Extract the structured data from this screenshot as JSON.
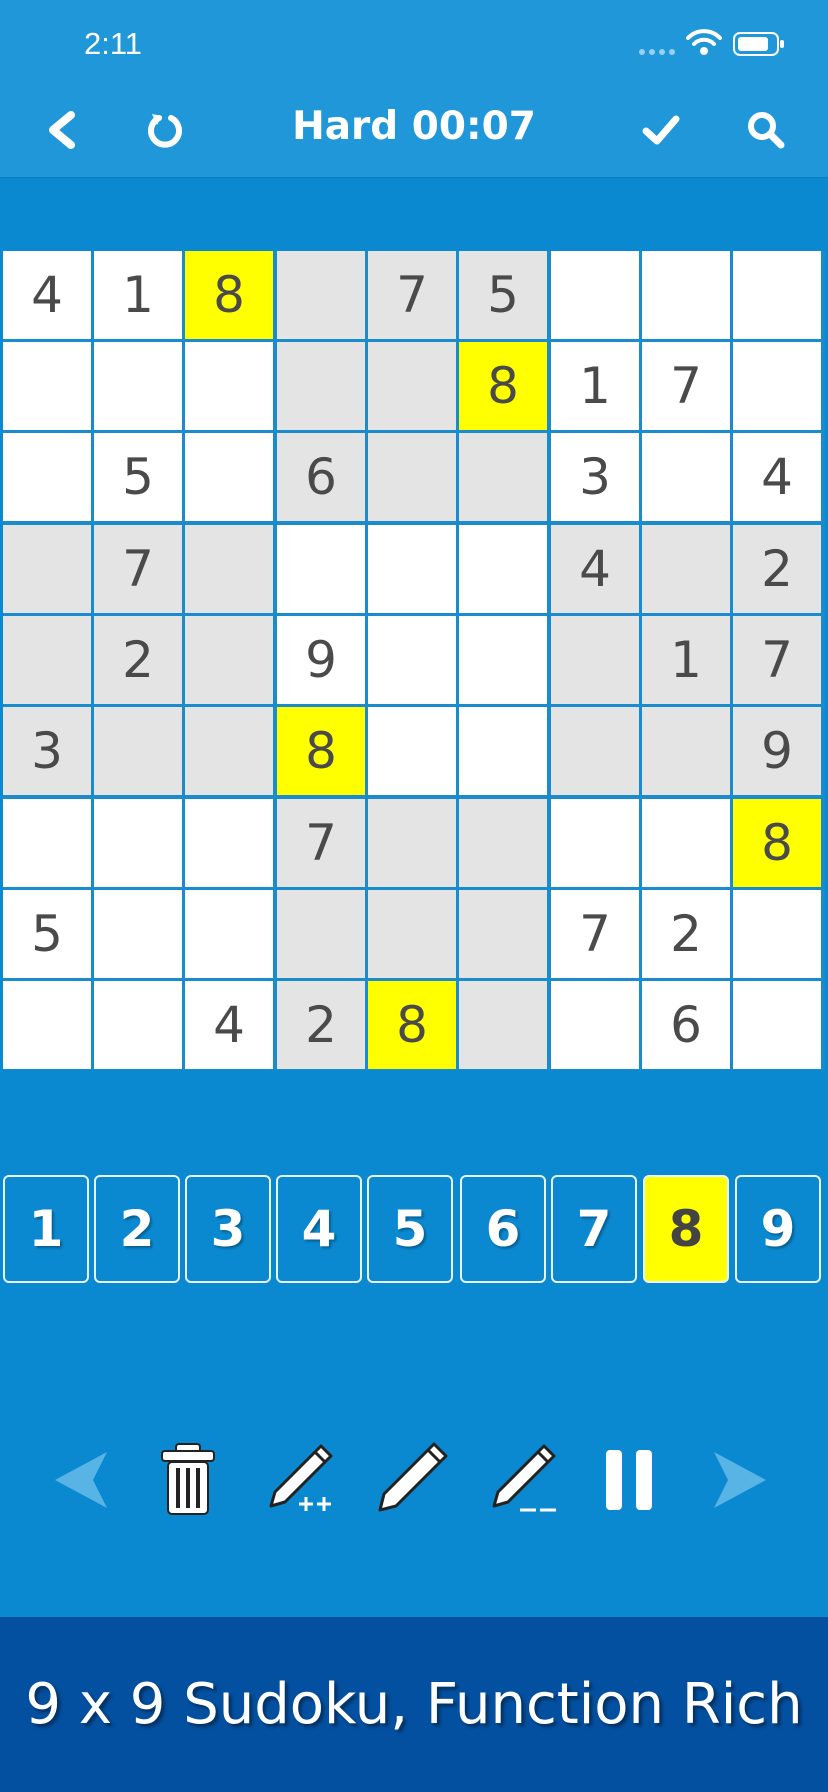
{
  "status_bar": {
    "time": "2:11"
  },
  "header": {
    "title": "Hard 00:07"
  },
  "board": {
    "rows": [
      [
        "4",
        "1",
        "8",
        "",
        "7",
        "5",
        "",
        "",
        ""
      ],
      [
        "",
        "",
        "",
        "",
        "",
        "8",
        "1",
        "7",
        ""
      ],
      [
        "",
        "5",
        "",
        "6",
        "",
        "",
        "3",
        "",
        "4"
      ],
      [
        "",
        "7",
        "",
        "",
        "",
        "",
        "4",
        "",
        "2"
      ],
      [
        "",
        "2",
        "",
        "9",
        "",
        "",
        "",
        "1",
        "7"
      ],
      [
        "3",
        "",
        "",
        "8",
        "",
        "",
        "",
        "",
        "9"
      ],
      [
        "",
        "",
        "",
        "7",
        "",
        "",
        "",
        "",
        "8"
      ],
      [
        "5",
        "",
        "",
        "",
        "",
        "",
        "7",
        "2",
        ""
      ],
      [
        "",
        "",
        "4",
        "2",
        "8",
        "",
        "",
        "6",
        ""
      ]
    ],
    "highlighted_digit": "8"
  },
  "number_pad": [
    "1",
    "2",
    "3",
    "4",
    "5",
    "6",
    "7",
    "8",
    "9"
  ],
  "toolbar": {
    "icons": [
      "undo-arrow-icon",
      "trash-icon",
      "pencil-plus-icon",
      "pencil-icon",
      "pencil-minus-icon",
      "pause-icon",
      "redo-arrow-icon"
    ]
  },
  "banner": {
    "text": "9 x 9 Sudoku, Function Rich"
  },
  "colors": {
    "background": "#0a88d0",
    "header": "#1f97d8",
    "highlight": "#ffff00",
    "shaded_cell": "#e4e4e4",
    "banner": "#0450a0"
  }
}
